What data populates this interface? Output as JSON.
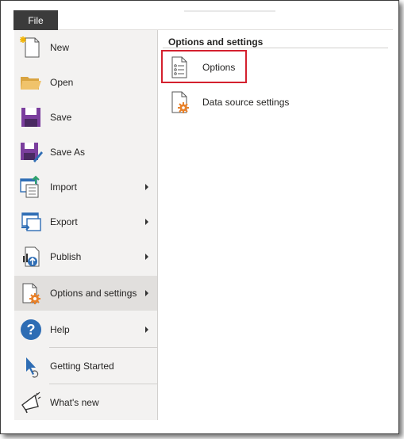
{
  "file_tab": {
    "label": "File"
  },
  "menu": {
    "items": [
      {
        "label": "New",
        "icon": "new-file-icon",
        "has_submenu": false
      },
      {
        "label": "Open",
        "icon": "folder-open-icon",
        "has_submenu": false
      },
      {
        "label": "Save",
        "icon": "save-icon",
        "has_submenu": false
      },
      {
        "label": "Save As",
        "icon": "save-as-icon",
        "has_submenu": false
      },
      {
        "label": "Import",
        "icon": "import-icon",
        "has_submenu": true
      },
      {
        "label": "Export",
        "icon": "export-icon",
        "has_submenu": true
      },
      {
        "label": "Publish",
        "icon": "publish-icon",
        "has_submenu": true
      },
      {
        "label": "Options and settings",
        "icon": "options-settings-icon",
        "has_submenu": true,
        "selected": true
      },
      {
        "label": "Help",
        "icon": "help-icon",
        "has_submenu": true
      },
      {
        "label": "Getting Started",
        "icon": "getting-started-icon",
        "has_submenu": false
      },
      {
        "label": "What's new",
        "icon": "megaphone-icon",
        "has_submenu": false
      }
    ]
  },
  "panel": {
    "title": "Options and settings",
    "items": [
      {
        "label": "Options",
        "icon": "options-document-icon",
        "highlighted": true
      },
      {
        "label": "Data source settings",
        "icon": "data-source-settings-icon"
      }
    ]
  },
  "colors": {
    "file_tab_bg": "#3b3b3b",
    "selected_bg": "#e1dfdd",
    "menu_bg": "#f3f2f1",
    "highlight_border": "#d4202e",
    "accent_purple": "#7b3f9e",
    "accent_orange": "#e8812a",
    "accent_blue": "#2e6db4"
  }
}
